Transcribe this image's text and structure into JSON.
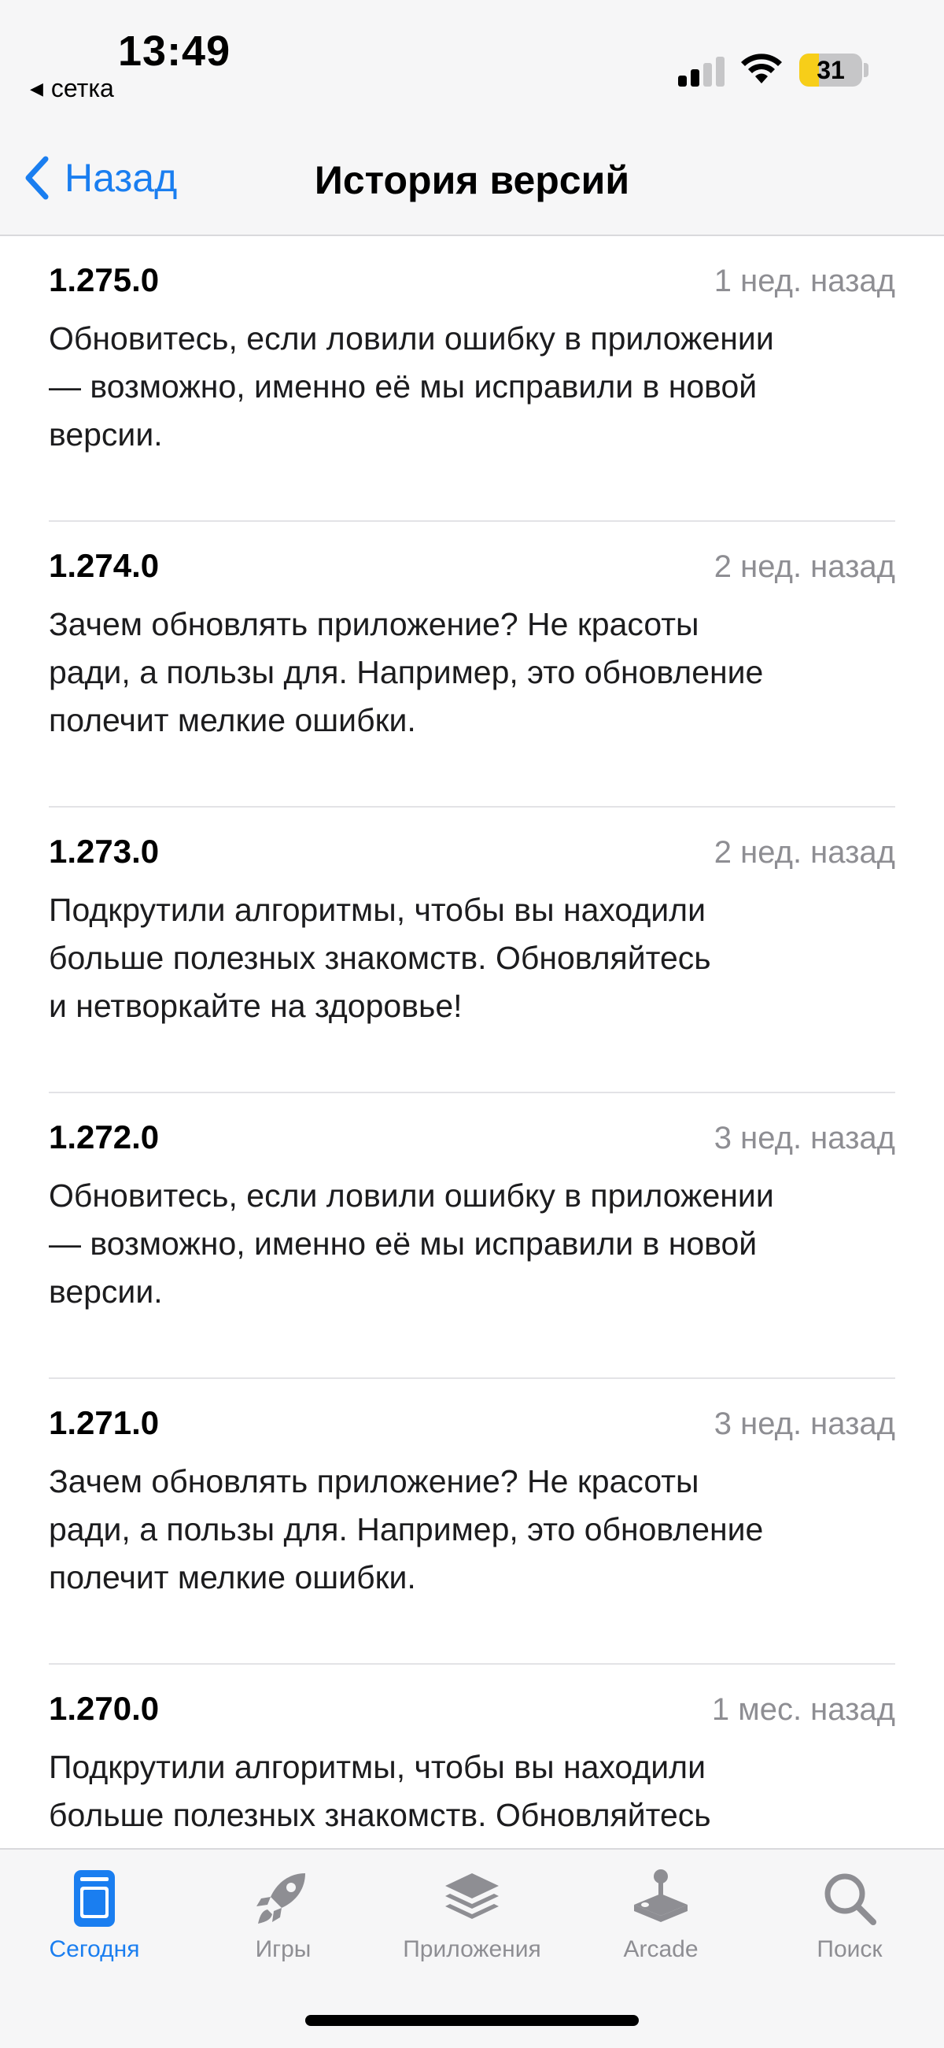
{
  "status": {
    "time": "13:49",
    "back_app": "сетка",
    "battery": "31",
    "battery_level": 0.31
  },
  "nav": {
    "back_label": "Назад",
    "title": "История версий"
  },
  "entries": [
    {
      "version": "1.275.0",
      "ago": "1 нед. назад",
      "notes": "Обновитесь, если ловили ошибку в приложении\n— возможно, именно её мы исправили в новой\nверсии."
    },
    {
      "version": "1.274.0",
      "ago": "2 нед. назад",
      "notes": "Зачем обновлять приложение? Не красоты\nради, а пользы для. Например, это обновление\nполечит мелкие ошибки."
    },
    {
      "version": "1.273.0",
      "ago": "2 нед. назад",
      "notes": "Подкрутили алгоритмы, чтобы вы находили\nбольше полезных знакомств. Обновляйтесь\nи нетворкайте на здоровье!"
    },
    {
      "version": "1.272.0",
      "ago": "3 нед. назад",
      "notes": "Обновитесь, если ловили ошибку в приложении\n— возможно, именно её мы исправили в новой\nверсии."
    },
    {
      "version": "1.271.0",
      "ago": "3 нед. назад",
      "notes": "Зачем обновлять приложение? Не красоты\nради, а пользы для. Например, это обновление\nполечит мелкие ошибки."
    },
    {
      "version": "1.270.0",
      "ago": "1 мес. назад",
      "notes": "Подкрутили алгоритмы, чтобы вы находили\nбольше полезных знакомств. Обновляйтесь"
    }
  ],
  "tabbar": {
    "tabs": [
      {
        "label": "Сегодня",
        "icon": "today-icon",
        "active": true
      },
      {
        "label": "Игры",
        "icon": "rocket-icon",
        "active": false
      },
      {
        "label": "Приложения",
        "icon": "layers-icon",
        "active": false
      },
      {
        "label": "Arcade",
        "icon": "joystick-icon",
        "active": false
      },
      {
        "label": "Поиск",
        "icon": "search-icon",
        "active": false
      }
    ]
  },
  "colors": {
    "accent": "#1a7ef0",
    "secondary_text": "#8e8e93",
    "battery_fill": "#f7ce19"
  }
}
